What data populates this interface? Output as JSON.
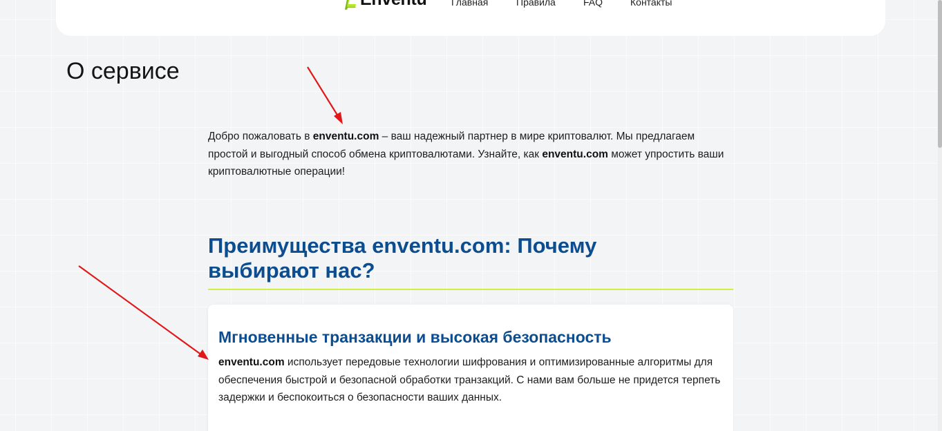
{
  "header": {
    "logo_text": "Enventu",
    "nav": [
      "Главная",
      "Правила",
      "FAQ",
      "Контакты"
    ]
  },
  "page_title": "О сервисе",
  "intro": {
    "p1": "Добро пожаловать в ",
    "brand1": "enventu.com",
    "p2": " – ваш надежный партнер в мире криптовалют. Мы предлагаем простой и выгодный способ обмена криптовалютами. Узнайте, как ",
    "brand2": "enventu.com",
    "p3": " может упростить ваши криптовалютные операции!"
  },
  "section": {
    "title": "Преимущества enventu.com: Почему выбирают нас?"
  },
  "card": {
    "title": "Мгновенные транзакции и высокая безопасность",
    "brand": "enventu.com",
    "text": " использует передовые технологии шифрования и оптимизированные алгоритмы для обеспечения быстрой и безопасной обработки транзакций. С нами вам больше не придется терпеть задержки и беспокоиться о безопасности ваших данных."
  },
  "colors": {
    "heading_blue": "#0b4d8f",
    "accent_lime": "#d4ef3b",
    "annotation_red": "#e01818"
  }
}
